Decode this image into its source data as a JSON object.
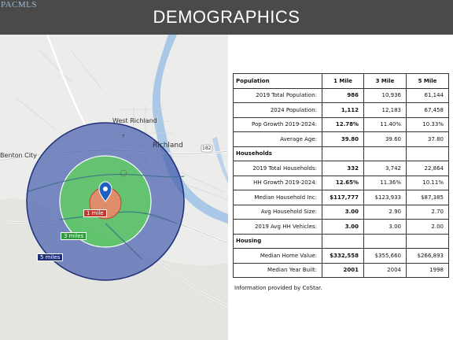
{
  "header": {
    "logo": "PACMLS",
    "title": "DEMOGRAPHICS"
  },
  "map": {
    "places": {
      "west_richland": "West Richland",
      "richland": "Richland",
      "benton_city": "Benton City"
    },
    "highway_number": "182",
    "road_marker": "7",
    "rings": {
      "one": "1 mile",
      "three": "3 miles",
      "five": "5 miles"
    },
    "colors": {
      "five_mile": "#4a5fae",
      "three_mile": "#5fce62",
      "one_mile": "#e98a6a",
      "pin": "#1f5fbf",
      "river": "#a9c7e6"
    }
  },
  "table": {
    "columns": [
      "1 Mile",
      "3 Mile",
      "5 Mile"
    ],
    "sections": [
      {
        "title": "Population",
        "rows": [
          {
            "label": "2019 Total Population:",
            "values": [
              "986",
              "10,936",
              "61,144"
            ]
          },
          {
            "label": "2024 Population:",
            "values": [
              "1,112",
              "12,183",
              "67,458"
            ]
          },
          {
            "label": "Pop Growth 2019-2024:",
            "values": [
              "12.78%",
              "11.40%",
              "10.33%"
            ]
          },
          {
            "label": "Average Age:",
            "values": [
              "39.80",
              "39.60",
              "37.80"
            ]
          }
        ]
      },
      {
        "title": "Households",
        "rows": [
          {
            "label": "2019 Total Households:",
            "values": [
              "332",
              "3,742",
              "22,864"
            ]
          },
          {
            "label": "HH Growth 2019-2024:",
            "values": [
              "12.65%",
              "11.36%",
              "10.11%"
            ]
          },
          {
            "label": "Median Household Inc:",
            "values": [
              "$117,777",
              "$123,933",
              "$87,385"
            ]
          },
          {
            "label": "Avg Household Size:",
            "values": [
              "3.00",
              "2.90",
              "2.70"
            ]
          },
          {
            "label": "2019 Avg HH Vehicles:",
            "values": [
              "3.00",
              "3.00",
              "2.00"
            ]
          }
        ]
      },
      {
        "title": "Housing",
        "rows": [
          {
            "label": "Median Home Value:",
            "values": [
              "$332,558",
              "$355,660",
              "$266,893"
            ]
          },
          {
            "label": "Median Year Built:",
            "values": [
              "2001",
              "2004",
              "1998"
            ]
          }
        ]
      }
    ],
    "source": "Information provided by CoStar."
  }
}
